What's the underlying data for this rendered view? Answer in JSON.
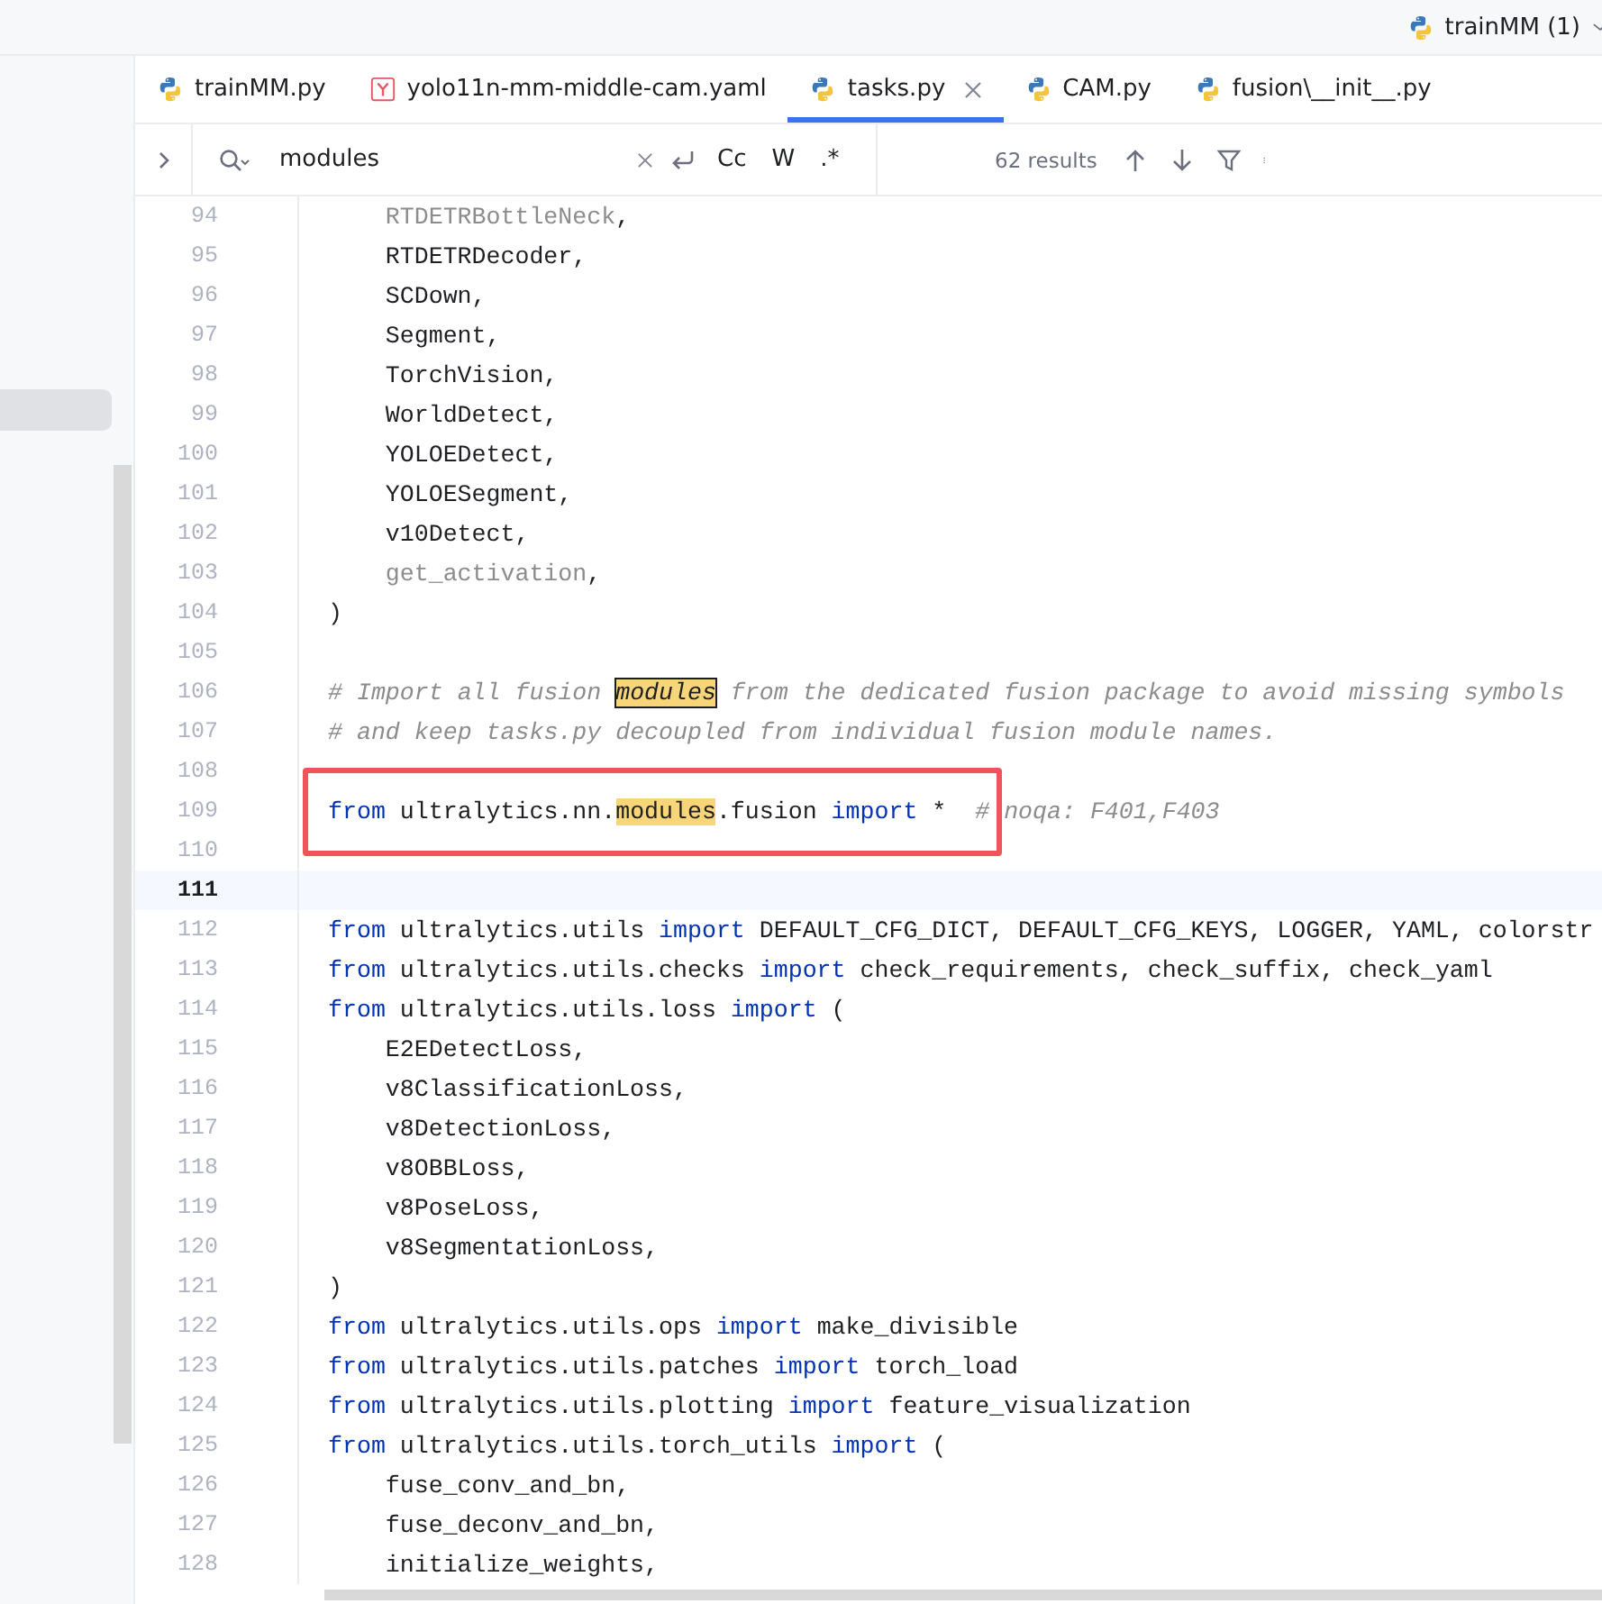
{
  "project": {
    "label": "trainMM (1)"
  },
  "tabs": [
    {
      "label": "trainMM.py",
      "kind": "python",
      "selected": false
    },
    {
      "label": "yolo11n-mm-middle-cam.yaml",
      "kind": "yaml",
      "selected": false
    },
    {
      "label": "tasks.py",
      "kind": "python",
      "selected": true
    },
    {
      "label": "CAM.py",
      "kind": "python",
      "selected": false
    },
    {
      "label": "fusion\\__init__.py",
      "kind": "python",
      "selected": false
    }
  ],
  "search": {
    "value": "modules",
    "options": [
      {
        "label": "Cc",
        "selected": false
      },
      {
        "label": "W",
        "selected": false
      },
      {
        "label": ".*",
        "selected": false
      }
    ],
    "results": "62 results"
  },
  "lines": [
    {
      "number": "94",
      "current": false,
      "indented": true,
      "tokens": [
        {
          "kind": "unused",
          "text": "RTDETRBottleNeck"
        },
        {
          "kind": "text",
          "text": ","
        }
      ]
    },
    {
      "number": "95",
      "current": false,
      "indented": true,
      "tokens": [
        {
          "kind": "text",
          "text": "RTDETRDecoder,"
        }
      ]
    },
    {
      "number": "96",
      "current": false,
      "indented": true,
      "tokens": [
        {
          "kind": "text",
          "text": "SCDown,"
        }
      ]
    },
    {
      "number": "97",
      "current": false,
      "indented": true,
      "tokens": [
        {
          "kind": "text",
          "text": "Segment,"
        }
      ]
    },
    {
      "number": "98",
      "current": false,
      "indented": true,
      "tokens": [
        {
          "kind": "text",
          "text": "TorchVision,"
        }
      ]
    },
    {
      "number": "99",
      "current": false,
      "indented": true,
      "tokens": [
        {
          "kind": "text",
          "text": "WorldDetect,"
        }
      ]
    },
    {
      "number": "100",
      "current": false,
      "indented": true,
      "tokens": [
        {
          "kind": "text",
          "text": "YOLOEDetect,"
        }
      ]
    },
    {
      "number": "101",
      "current": false,
      "indented": true,
      "tokens": [
        {
          "kind": "text",
          "text": "YOLOESegment,"
        }
      ]
    },
    {
      "number": "102",
      "current": false,
      "indented": true,
      "tokens": [
        {
          "kind": "text",
          "text": "v10Detect,"
        }
      ]
    },
    {
      "number": "103",
      "current": false,
      "indented": true,
      "tokens": [
        {
          "kind": "unused",
          "text": "get_activation"
        },
        {
          "kind": "text",
          "text": ","
        }
      ]
    },
    {
      "number": "104",
      "current": false,
      "indented": false,
      "tokens": [
        {
          "kind": "text",
          "text": ")"
        }
      ]
    },
    {
      "number": "105",
      "current": false
    },
    {
      "number": "106",
      "current": false,
      "indented": false,
      "tokens": [
        {
          "kind": "comment",
          "text": "# Import all fusion "
        },
        {
          "kind": "current_match",
          "text": "modules"
        },
        {
          "kind": "comment",
          "text": " from the dedicated fusion package to avoid missing symbols"
        }
      ]
    },
    {
      "number": "107",
      "current": false,
      "indented": false,
      "tokens": [
        {
          "kind": "comment",
          "text": "# and keep tasks.py decoupled from individual fusion module names."
        }
      ]
    },
    {
      "number": "108",
      "current": false
    },
    {
      "number": "109",
      "current": false,
      "indented": false,
      "boxed": true,
      "tokens": [
        {
          "kind": "keyword",
          "text": "from"
        },
        {
          "kind": "text",
          "text": " ultralytics.nn."
        },
        {
          "kind": "match",
          "text": "modules"
        },
        {
          "kind": "text",
          "text": ".fusion "
        },
        {
          "kind": "keyword",
          "text": "import"
        },
        {
          "kind": "text",
          "text": " *  "
        },
        {
          "kind": "comment",
          "text": "# noqa: F401,F403"
        }
      ]
    },
    {
      "number": "110",
      "current": false
    },
    {
      "number": "111",
      "current": true
    },
    {
      "number": "112",
      "current": false,
      "indented": false,
      "tokens": [
        {
          "kind": "keyword",
          "text": "from"
        },
        {
          "kind": "text",
          "text": " ultralytics.utils "
        },
        {
          "kind": "keyword",
          "text": "import"
        },
        {
          "kind": "text",
          "text": " DEFAULT_CFG_DICT, DEFAULT_CFG_KEYS, LOGGER, YAML, colorstr"
        }
      ]
    },
    {
      "number": "113",
      "current": false,
      "indented": false,
      "tokens": [
        {
          "kind": "keyword",
          "text": "from"
        },
        {
          "kind": "text",
          "text": " ultralytics.utils.checks "
        },
        {
          "kind": "keyword",
          "text": "import"
        },
        {
          "kind": "text",
          "text": " check_requirements, check_suffix, check_yaml"
        }
      ]
    },
    {
      "number": "114",
      "current": false,
      "indented": false,
      "tokens": [
        {
          "kind": "keyword",
          "text": "from"
        },
        {
          "kind": "text",
          "text": " ultralytics.utils.loss "
        },
        {
          "kind": "keyword",
          "text": "import"
        },
        {
          "kind": "text",
          "text": " ("
        }
      ]
    },
    {
      "number": "115",
      "current": false,
      "indented": true,
      "tokens": [
        {
          "kind": "text",
          "text": "E2EDetectLoss,"
        }
      ]
    },
    {
      "number": "116",
      "current": false,
      "indented": true,
      "tokens": [
        {
          "kind": "text",
          "text": "v8ClassificationLoss,"
        }
      ]
    },
    {
      "number": "117",
      "current": false,
      "indented": true,
      "tokens": [
        {
          "kind": "text",
          "text": "v8DetectionLoss,"
        }
      ]
    },
    {
      "number": "118",
      "current": false,
      "indented": true,
      "tokens": [
        {
          "kind": "text",
          "text": "v8OBBLoss,"
        }
      ]
    },
    {
      "number": "119",
      "current": false,
      "indented": true,
      "tokens": [
        {
          "kind": "text",
          "text": "v8PoseLoss,"
        }
      ]
    },
    {
      "number": "120",
      "current": false,
      "indented": true,
      "tokens": [
        {
          "kind": "text",
          "text": "v8SegmentationLoss,"
        }
      ]
    },
    {
      "number": "121",
      "current": false,
      "indented": false,
      "tokens": [
        {
          "kind": "text",
          "text": ")"
        }
      ]
    },
    {
      "number": "122",
      "current": false,
      "indented": false,
      "tokens": [
        {
          "kind": "keyword",
          "text": "from"
        },
        {
          "kind": "text",
          "text": " ultralytics.utils.ops "
        },
        {
          "kind": "keyword",
          "text": "import"
        },
        {
          "kind": "text",
          "text": " make_divisible"
        }
      ]
    },
    {
      "number": "123",
      "current": false,
      "indented": false,
      "tokens": [
        {
          "kind": "keyword",
          "text": "from"
        },
        {
          "kind": "text",
          "text": " ultralytics.utils.patches "
        },
        {
          "kind": "keyword",
          "text": "import"
        },
        {
          "kind": "text",
          "text": " torch_load"
        }
      ]
    },
    {
      "number": "124",
      "current": false,
      "indented": false,
      "tokens": [
        {
          "kind": "keyword",
          "text": "from"
        },
        {
          "kind": "text",
          "text": " ultralytics.utils.plotting "
        },
        {
          "kind": "keyword",
          "text": "import"
        },
        {
          "kind": "text",
          "text": " feature_visualization"
        }
      ]
    },
    {
      "number": "125",
      "current": false,
      "indented": false,
      "tokens": [
        {
          "kind": "keyword",
          "text": "from"
        },
        {
          "kind": "text",
          "text": " ultralytics.utils.torch_utils "
        },
        {
          "kind": "keyword",
          "text": "import"
        },
        {
          "kind": "text",
          "text": " ("
        }
      ]
    },
    {
      "number": "126",
      "current": false,
      "indented": true,
      "tokens": [
        {
          "kind": "text",
          "text": "fuse_conv_and_bn,"
        }
      ]
    },
    {
      "number": "127",
      "current": false,
      "indented": true,
      "tokens": [
        {
          "kind": "text",
          "text": "fuse_deconv_and_bn,"
        }
      ]
    },
    {
      "number": "128",
      "current": false,
      "indented": true,
      "tokens": [
        {
          "kind": "text",
          "text": "initialize_weights,"
        }
      ]
    }
  ]
}
